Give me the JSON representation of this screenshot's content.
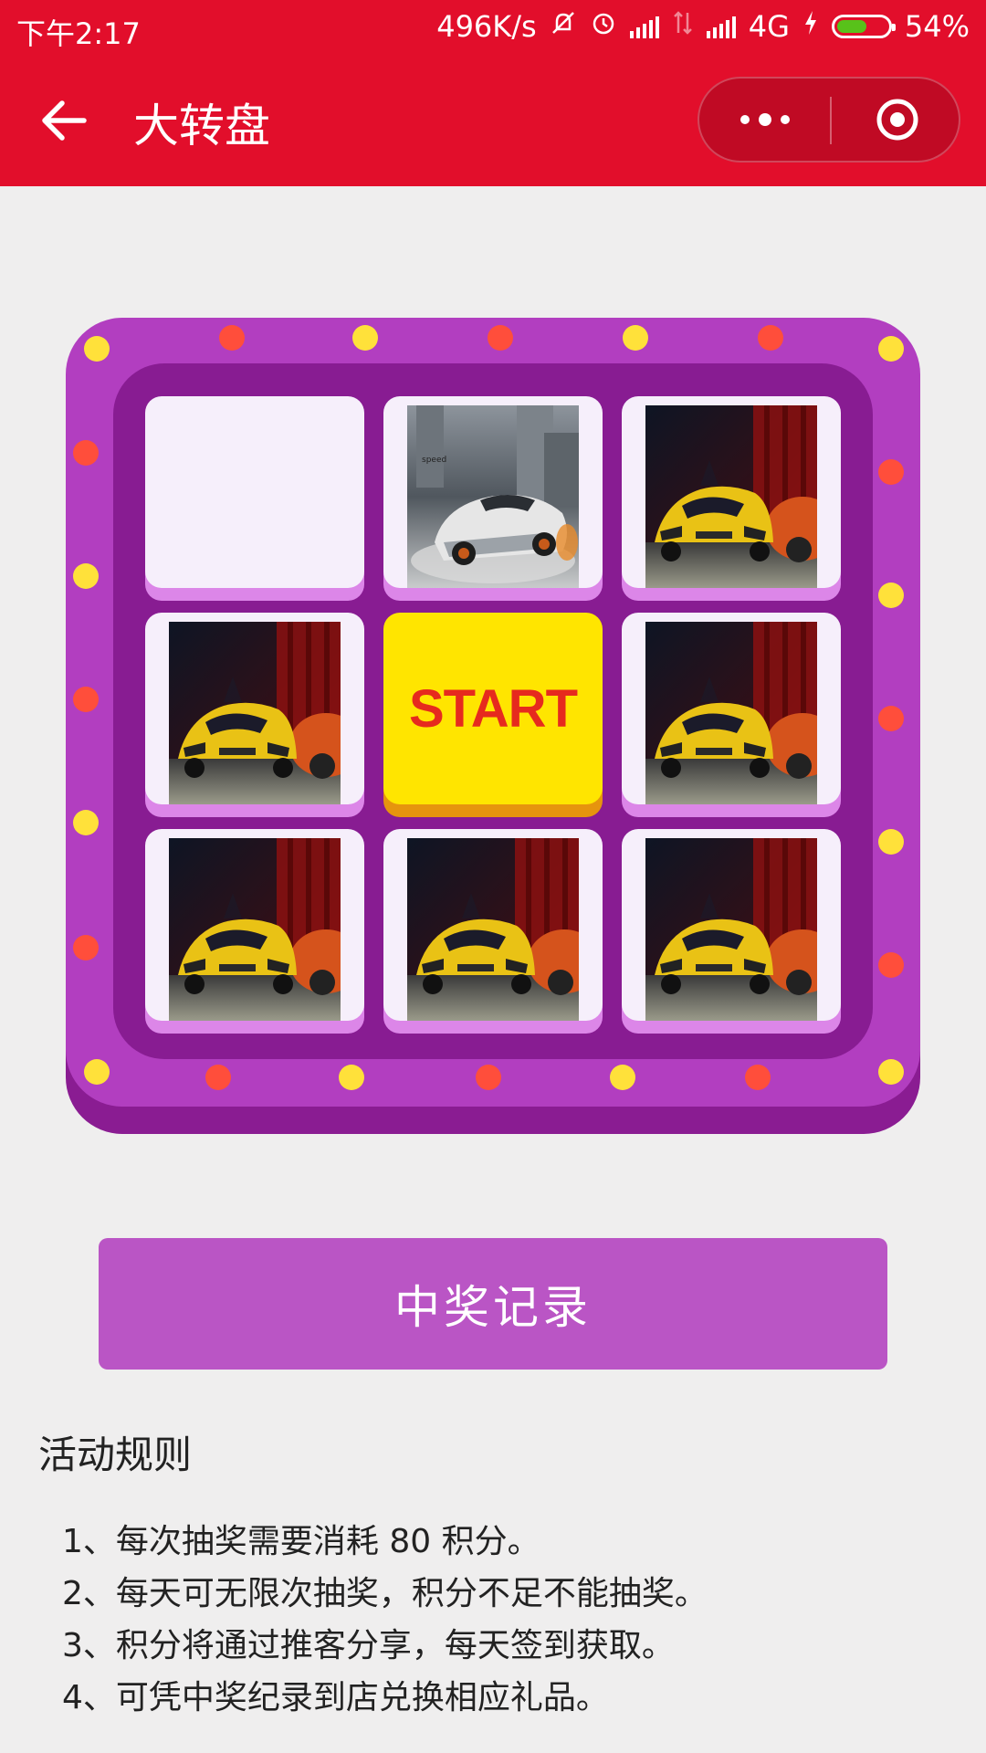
{
  "status_bar": {
    "time": "下午2:17",
    "speed": "496K/s",
    "network": "4G",
    "battery": "54%"
  },
  "nav": {
    "title": "大转盘"
  },
  "prizes": [
    {
      "image": "empty-slot"
    },
    {
      "image": "silver-sports-car"
    },
    {
      "image": "yellow-sports-car"
    },
    {
      "image": "yellow-sports-car"
    },
    {
      "image": "yellow-sports-car"
    },
    {
      "image": "yellow-sports-car"
    },
    {
      "image": "yellow-sports-car"
    },
    {
      "image": "yellow-sports-car"
    }
  ],
  "start_label": "START",
  "record_button": "中奖记录",
  "rules": {
    "title": "活动规则",
    "items": [
      "1、每次抽奖需要消耗 80 积分。",
      "2、每天可无限次抽奖，积分不足不能抽奖。",
      "3、积分将通过推客分享，每天签到获取。",
      "4、可凭中奖纪录到店兑换相应礼品。"
    ]
  },
  "colors": {
    "brand_red": "#e20e2b",
    "board_purple": "#b23ec0",
    "inner_purple": "#881c92",
    "start_yellow": "#ffe500",
    "button_purple": "#ba55c5"
  }
}
